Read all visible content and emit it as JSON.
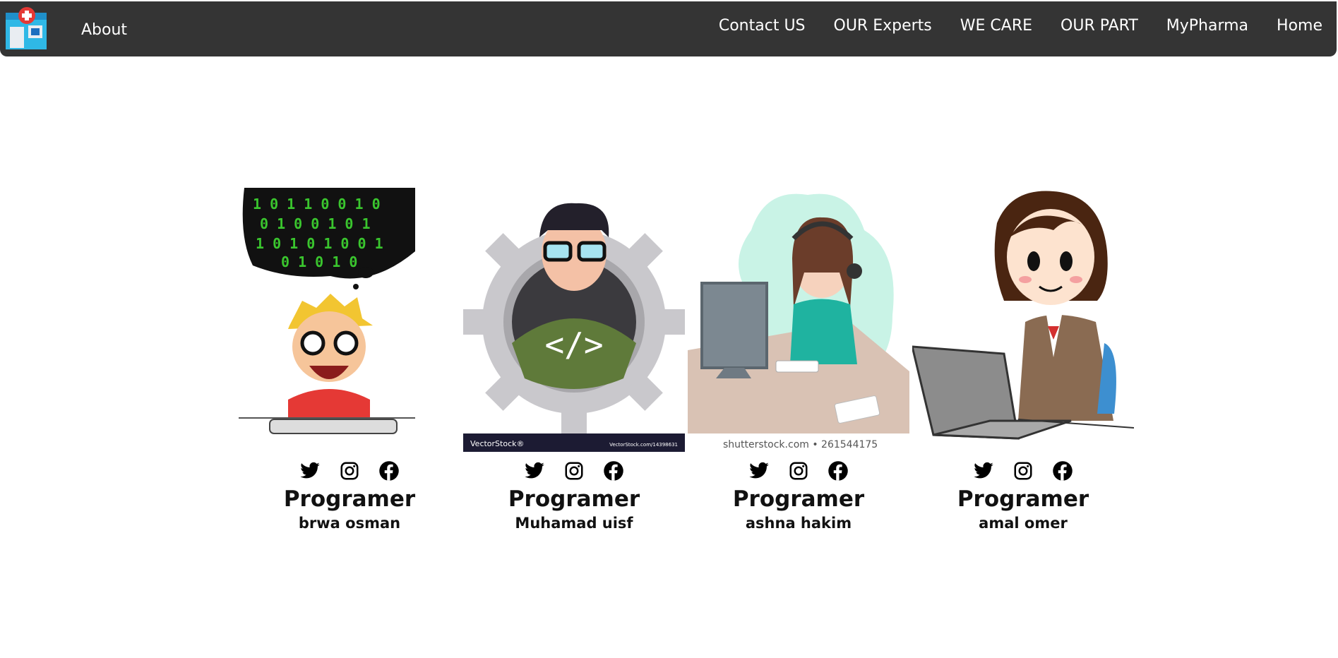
{
  "nav": {
    "about": "About",
    "links": [
      "Contact US",
      "OUR Experts",
      "WE CARE",
      "OUR PART",
      "MyPharma",
      "Home"
    ]
  },
  "cards": [
    {
      "role": "Programer",
      "name": "brwa osman"
    },
    {
      "role": "Programer",
      "name": "Muhamad uisf",
      "watermark_left": "VectorStock®",
      "watermark_right": "VectorStock.com/14398631"
    },
    {
      "role": "Programer",
      "name": "ashna hakim",
      "watermark": "shutterstock.com • 261544175"
    },
    {
      "role": "Programer",
      "name": "amal omer"
    }
  ],
  "social_icons": [
    "twitter-icon",
    "instagram-icon",
    "facebook-icon"
  ],
  "colors": {
    "navbar": "#343434",
    "nav_text": "#ffffff",
    "text": "#111111"
  }
}
